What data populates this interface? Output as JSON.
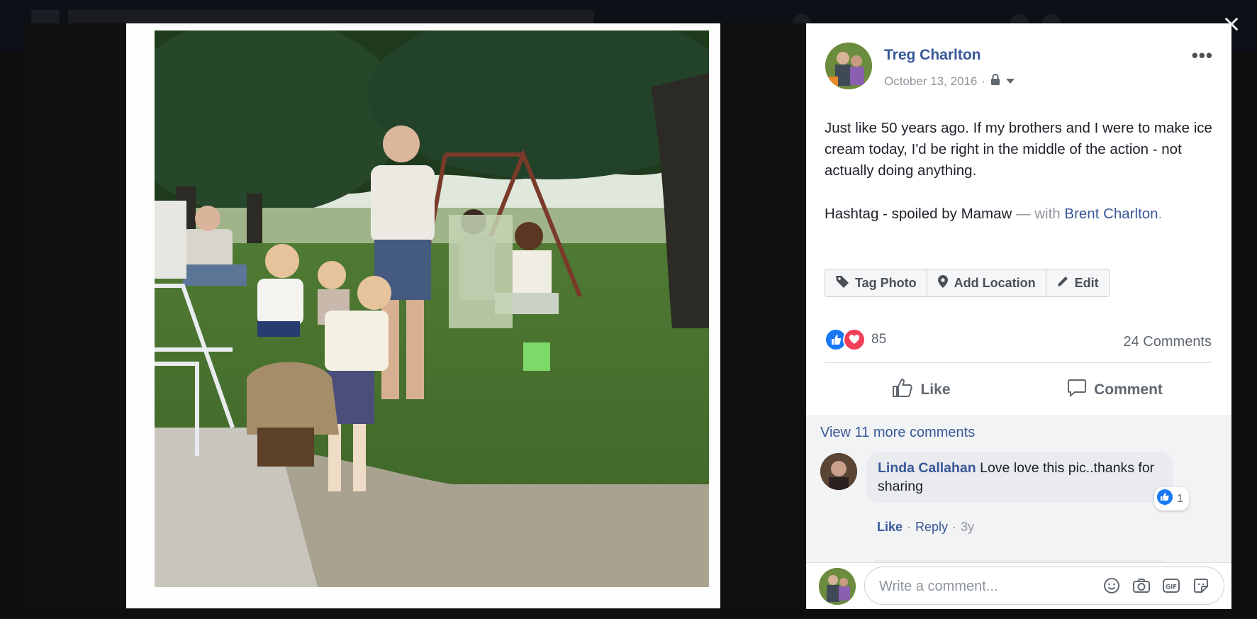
{
  "overlay": {
    "close_label": "×"
  },
  "post": {
    "author": "Treg Charlton",
    "date": "October 13, 2016",
    "date_separator": "·",
    "privacy_icon": "lock-icon",
    "more_label": "•••",
    "caption_line1": "Just like 50 years ago. If my brothers and I were to make ice cream today, I'd be right in the middle of the action - not actually doing anything.",
    "caption_line2_text": "Hashtag - spoiled by Mamaw",
    "caption_with": " — with ",
    "tagged_person": "Brent Charlton",
    "caption_end": "."
  },
  "photo_actions": [
    {
      "label": "Tag Photo",
      "icon": "tag-icon"
    },
    {
      "label": "Add Location",
      "icon": "location-pin-icon"
    },
    {
      "label": "Edit",
      "icon": "pencil-icon"
    }
  ],
  "reactions": {
    "count": "85",
    "types": [
      "like",
      "love"
    ],
    "comments_label": "24 Comments"
  },
  "buttons": {
    "like": "Like",
    "comment": "Comment"
  },
  "comments": {
    "view_more": "View 11 more comments",
    "items": [
      {
        "name": "Linda Callahan",
        "text": " Love love this pic..thanks for sharing",
        "like_count": "1",
        "actions_like": "Like",
        "actions_reply": "Reply",
        "age": "3y",
        "dot": "·"
      }
    ]
  },
  "composer": {
    "placeholder": "Write a comment..."
  },
  "colors": {
    "link": "#385898",
    "like_blue": "#1877f2",
    "love_red": "#f33e58",
    "page_bg": "#232323"
  }
}
